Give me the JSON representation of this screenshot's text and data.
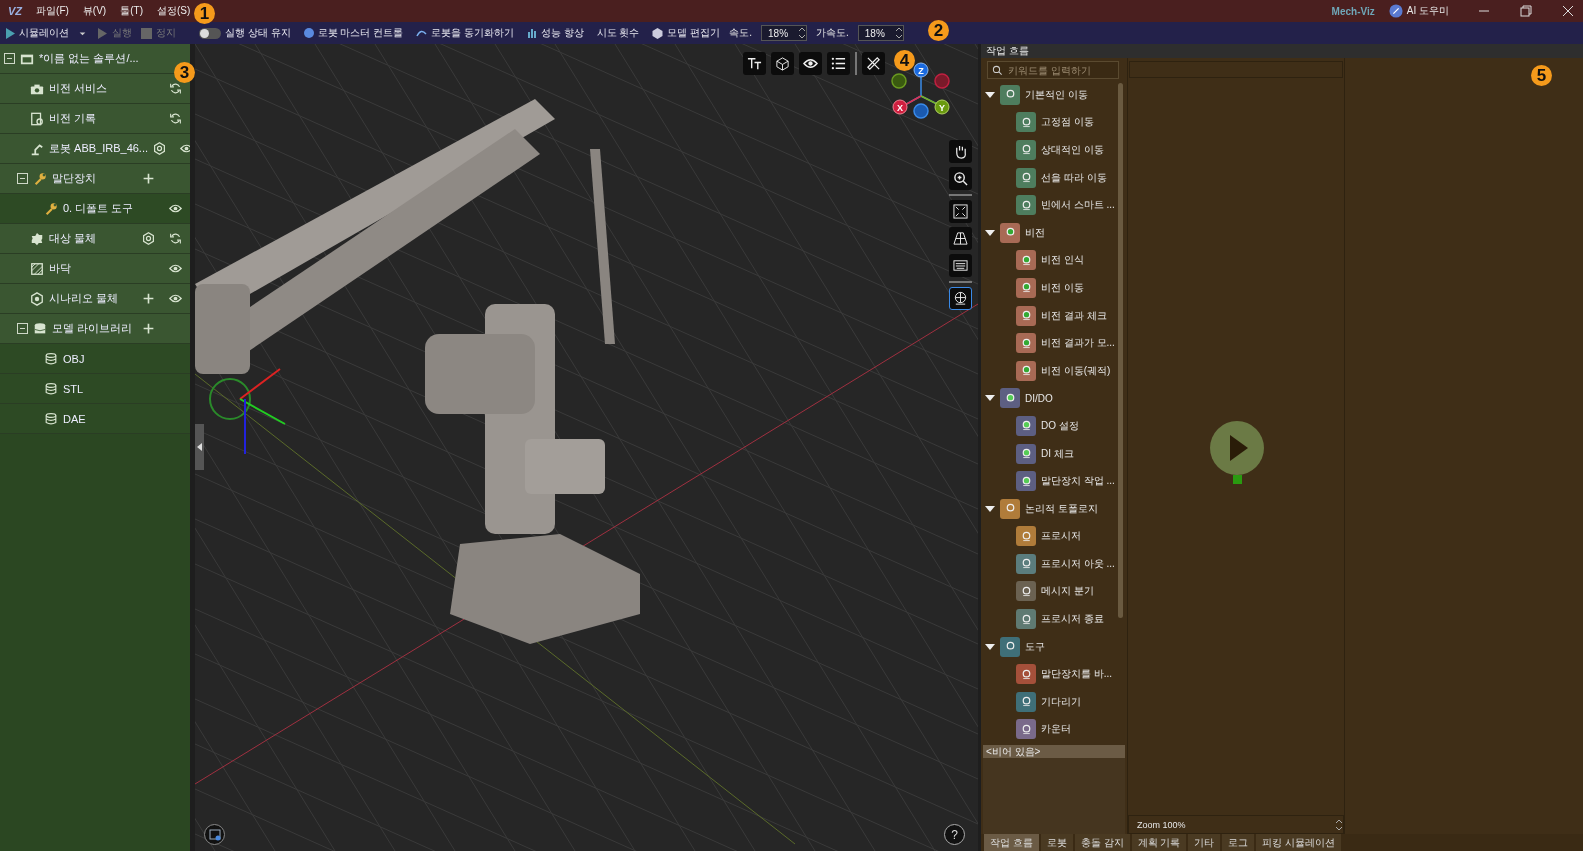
{
  "title_bar": {
    "logo": "VZ",
    "menu": [
      "파일(F)",
      "뷰(V)",
      "툴(T)",
      "설정(S)"
    ],
    "app_name": "Mech-Viz",
    "assistant": "AI 도우미"
  },
  "toolbar": {
    "simulate": "시뮬레이션",
    "run": {
      "label": "실행",
      "disabled": true
    },
    "stop": {
      "label": "정지",
      "disabled": true
    },
    "keep_state": {
      "label": "실행 상태 유지",
      "on": false
    },
    "buttons": [
      {
        "kind": "master",
        "label": "로봇 마스터 컨트롤"
      },
      {
        "kind": "sync",
        "label": "로봇을 동기화하기"
      },
      {
        "kind": "perf",
        "label": "성능 향상"
      },
      {
        "kind": "plain",
        "label": "시도 횟수"
      },
      {
        "kind": "model",
        "label": "모델 편집기"
      }
    ],
    "speed": {
      "label": "속도.",
      "value": "18%"
    },
    "acceleration": {
      "label": "가속도.",
      "value": "18%"
    }
  },
  "solution_tree": {
    "label": "*이름 없는 솔루션/...",
    "expanded": true,
    "children": [
      {
        "kind": "camera",
        "label": "비전 서비스",
        "refresh": true
      },
      {
        "kind": "record",
        "label": "비전 기록",
        "refresh": true
      },
      {
        "kind": "robot",
        "label": "로봇 ABB_IRB_46...",
        "settings": true,
        "visible": true
      },
      {
        "kind": "tool",
        "label": "말단장치",
        "expanded": true,
        "add": true,
        "children": [
          {
            "kind": "tool",
            "label": "0. 디폴트 도구",
            "visible": true
          }
        ]
      },
      {
        "kind": "object",
        "label": "대상 물체",
        "settings": true,
        "refresh": true
      },
      {
        "kind": "floor",
        "label": "바닥",
        "visible": true
      },
      {
        "kind": "scene",
        "label": "시나리오 물체",
        "add": true,
        "visible": true
      },
      {
        "kind": "library",
        "label": "모델 라이브러리",
        "expanded": true,
        "add": true,
        "children": [
          {
            "kind": "model",
            "label": "OBJ"
          },
          {
            "kind": "model",
            "label": "STL"
          },
          {
            "kind": "model",
            "label": "DAE"
          }
        ]
      }
    ]
  },
  "viewport": {
    "axes": [
      "Z",
      "X",
      "Y"
    ],
    "help": "?"
  },
  "workflow": {
    "title": "작업 흐름",
    "search": {
      "placeholder": "키워드를 입력하기"
    },
    "categories": [
      {
        "label": "기본적인 이동",
        "color": "#4e7d5e",
        "expanded": true,
        "items": [
          {
            "label": "고정점 이동",
            "color": "#4e7d5e"
          },
          {
            "label": "상대적인 이동",
            "color": "#4e7d5e"
          },
          {
            "label": "선을 따라 이동",
            "color": "#4e7d5e"
          },
          {
            "label": "빈에서 스마트 ...",
            "color": "#4e7d5e"
          }
        ]
      },
      {
        "label": "비전",
        "color": "#a86a55",
        "expanded": true,
        "items": [
          {
            "label": "비전 인식",
            "color": "#a86a55"
          },
          {
            "label": "비전 이동",
            "color": "#a86a55"
          },
          {
            "label": "비전 결과 체크",
            "color": "#a86a55"
          },
          {
            "label": "비전 결과가 모...",
            "color": "#a86a55"
          },
          {
            "label": "비전 이동(궤적)",
            "color": "#a86a55"
          }
        ]
      },
      {
        "label": "DI/DO",
        "color": "#5d5f82",
        "expanded": true,
        "items": [
          {
            "label": "DO 설정",
            "color": "#5d5f82"
          },
          {
            "label": "DI 체크",
            "color": "#5d5f82"
          },
          {
            "label": "말단장치 작업 ...",
            "color": "#5d5f82"
          }
        ]
      },
      {
        "label": "논리적 토폴로지",
        "color": "#b07c3a",
        "expanded": true,
        "items": [
          {
            "label": "프로시저",
            "color": "#b07c3a"
          },
          {
            "label": "프로시저 아웃 ...",
            "color": "#5b7d7d"
          },
          {
            "label": "메시지 분기",
            "color": "#6b6252"
          },
          {
            "label": "프로시저 종료",
            "color": "#5f7a72"
          }
        ]
      },
      {
        "label": "도구",
        "color": "#3f6f78",
        "expanded": true,
        "items": [
          {
            "label": "말단장치를 바...",
            "color": "#a5503a"
          },
          {
            "label": "기다리기",
            "color": "#3f6f78"
          },
          {
            "label": "카운터",
            "color": "#7a6a8a"
          }
        ]
      }
    ],
    "info": "<비어 있음>",
    "zoom": "Zoom 100%"
  },
  "bottom_tabs": [
    {
      "label": "작업 흐름",
      "selected": true
    },
    {
      "label": "로봇",
      "selected": false
    },
    {
      "label": "충돌 감지",
      "selected": false
    },
    {
      "label": "계획 기록",
      "selected": false
    },
    {
      "label": "기타",
      "selected": false
    },
    {
      "label": "로그",
      "selected": false
    },
    {
      "label": "피킹 시뮬레이션",
      "selected": false
    }
  ],
  "annotations": [
    "1",
    "2",
    "3",
    "4",
    "5"
  ]
}
